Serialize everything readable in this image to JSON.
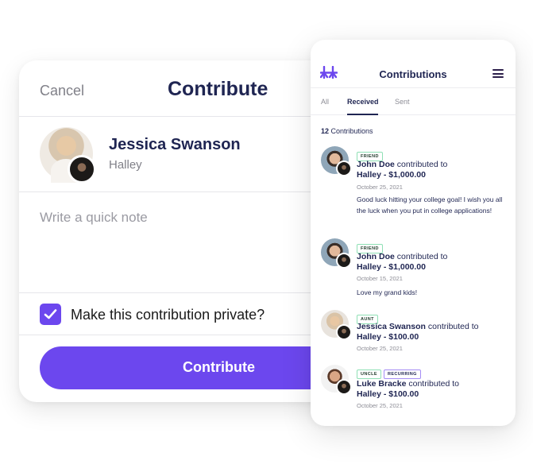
{
  "contribute_card": {
    "cancel_label": "Cancel",
    "title": "Contribute",
    "recipient": {
      "name": "Jessica Swanson",
      "subtitle": "Halley"
    },
    "note": {
      "placeholder": "Write a quick note",
      "value": ""
    },
    "private_checkbox": {
      "label": "Make this contribution private?",
      "checked": true
    },
    "submit_label": "Contribute",
    "accent_color": "#6c47ee"
  },
  "contributions_panel": {
    "title": "Contributions",
    "logo_icon": "brand-logo-icon",
    "menu_icon": "hamburger-menu-icon",
    "tabs": [
      {
        "label": "All",
        "active": false
      },
      {
        "label": "Received",
        "active": true
      },
      {
        "label": "Sent",
        "active": false
      }
    ],
    "count": "12",
    "count_label": "Contributions",
    "items": [
      {
        "badges": [
          "FRIEND"
        ],
        "contributor": "John Doe",
        "verb": "contributed to",
        "target_amount": "Halley - $1,000.00",
        "date": "October 25, 2021",
        "message": "Good luck hitting your college goal! I wish you all the luck when you put in college applications!"
      },
      {
        "badges": [
          "FRIEND"
        ],
        "contributor": "John Doe",
        "verb": "contributed to",
        "target_amount": "Halley - $1,000.00",
        "date": "October 15, 2021",
        "message": "Love my grand kids!"
      },
      {
        "badges": [
          "AUNT"
        ],
        "contributor": "Jessica Swanson",
        "verb": "contributed to",
        "target_amount": "Halley - $100.00",
        "date": "October 25, 2021",
        "message": ""
      },
      {
        "badges": [
          "UNCLE",
          "RECURRING"
        ],
        "contributor": "Luke Bracke",
        "verb": "contributed to",
        "target_amount": "Halley - $100.00",
        "date": "October 25, 2021",
        "message": ""
      }
    ]
  }
}
